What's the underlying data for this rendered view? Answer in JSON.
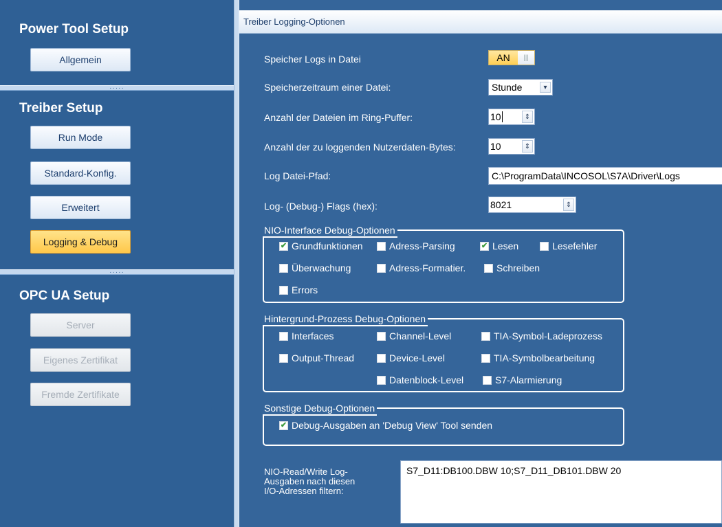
{
  "sidebar": {
    "sections": [
      {
        "title": "Power Tool Setup",
        "buttons": [
          "Allgemein"
        ]
      },
      {
        "title": "Treiber Setup",
        "buttons": [
          "Run Mode",
          "Standard-Konfig.",
          "Erweitert",
          "Logging & Debug"
        ]
      },
      {
        "title": "OPC UA Setup",
        "buttons": [
          "Server",
          "Eigenes Zertifikat",
          "Fremde Zertifikate"
        ]
      }
    ],
    "active_button": "Logging & Debug"
  },
  "header": {
    "title": "Treiber Logging-Optionen"
  },
  "settings": {
    "log_to_file": {
      "label": "Speicher Logs in Datei",
      "toggle_text": "AN",
      "toggle_grip": "|||"
    },
    "period": {
      "label": "Speicherzeitraum einer Datei:",
      "value": "Stunde"
    },
    "ring_files": {
      "label": "Anzahl der Dateien im Ring-Puffer:",
      "value": "10"
    },
    "payload_bytes": {
      "label": "Anzahl der zu loggenden Nutzerdaten-Bytes:",
      "value": "10"
    },
    "log_path": {
      "label": "Log Datei-Pfad:",
      "value": "C:\\ProgramData\\INCOSOL\\S7A\\Driver\\Logs"
    },
    "flags": {
      "label": "Log- (Debug-) Flags (hex):",
      "value": "8021"
    }
  },
  "groups": {
    "nio": {
      "title": "NIO-Interface Debug-Optionen",
      "options": [
        {
          "label": "Grundfunktionen",
          "checked": true
        },
        {
          "label": "Adress-Parsing",
          "checked": false
        },
        {
          "label": "Lesen",
          "checked": true
        },
        {
          "label": "Lesefehler",
          "checked": false
        },
        {
          "label": "Überwachung",
          "checked": false
        },
        {
          "label": "Adress-Formatier.",
          "checked": false
        },
        {
          "label": "Schreiben",
          "checked": false
        },
        {
          "label": "Errors",
          "checked": false
        }
      ]
    },
    "background": {
      "title": "Hintergrund-Prozess Debug-Optionen",
      "options": [
        {
          "label": "Interfaces",
          "checked": false
        },
        {
          "label": "Channel-Level",
          "checked": false
        },
        {
          "label": "TIA-Symbol-Ladeprozess",
          "checked": false
        },
        {
          "label": "Output-Thread",
          "checked": false
        },
        {
          "label": "Device-Level",
          "checked": false
        },
        {
          "label": "TIA-Symbolbearbeitung",
          "checked": false
        },
        {
          "label": "Datenblock-Level",
          "checked": false
        },
        {
          "label": "S7-Alarmierung",
          "checked": false
        }
      ]
    },
    "other": {
      "title": "Sonstige Debug-Optionen",
      "options": [
        {
          "label": "Debug-Ausgaben an 'Debug View' Tool senden",
          "checked": true
        }
      ]
    }
  },
  "filter": {
    "label_lines": [
      "NIO-Read/Write Log-",
      "Ausgaben nach diesen",
      "I/O-Adressen filtern:"
    ],
    "value": "S7_D11:DB100.DBW 10;S7_D11_DB101.DBW 20"
  },
  "icons": {
    "spinner": "⇕",
    "dropdown": "▾",
    "check": "✔"
  },
  "colors": {
    "background": "#35659a",
    "active": "#ffc84a",
    "check": "#3b9a3b"
  }
}
